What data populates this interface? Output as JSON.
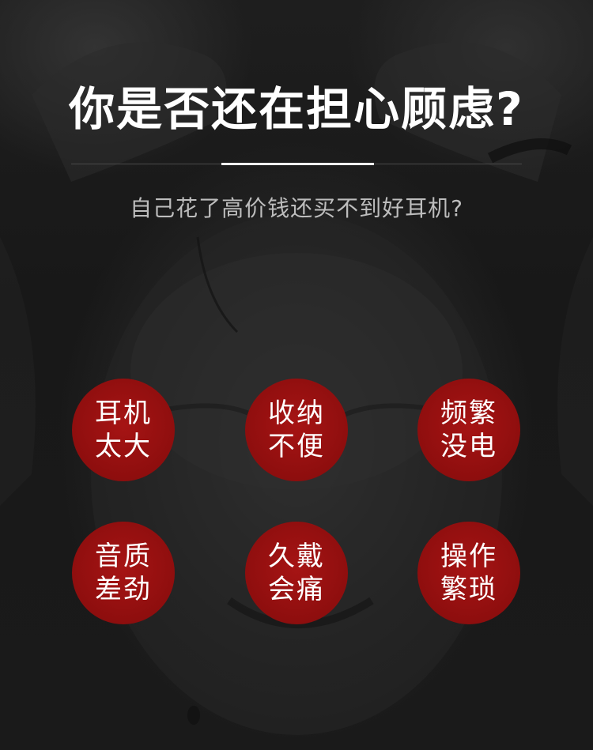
{
  "header": {
    "title": "你是否还在担心顾虑?",
    "subtitle": "自己花了高价钱还买不到好耳机?"
  },
  "concerns": [
    {
      "line1": "耳机",
      "line2": "太大"
    },
    {
      "line1": "收纳",
      "line2": "不便"
    },
    {
      "line1": "频繁",
      "line2": "没电"
    },
    {
      "line1": "音质",
      "line2": "差劲"
    },
    {
      "line1": "久戴",
      "line2": "会痛"
    },
    {
      "line1": "操作",
      "line2": "繁琐"
    }
  ],
  "colors": {
    "background": "#1a1a1a",
    "circle": "#8e0e0e",
    "title": "#ffffff",
    "subtitle": "#bdbdbd"
  }
}
